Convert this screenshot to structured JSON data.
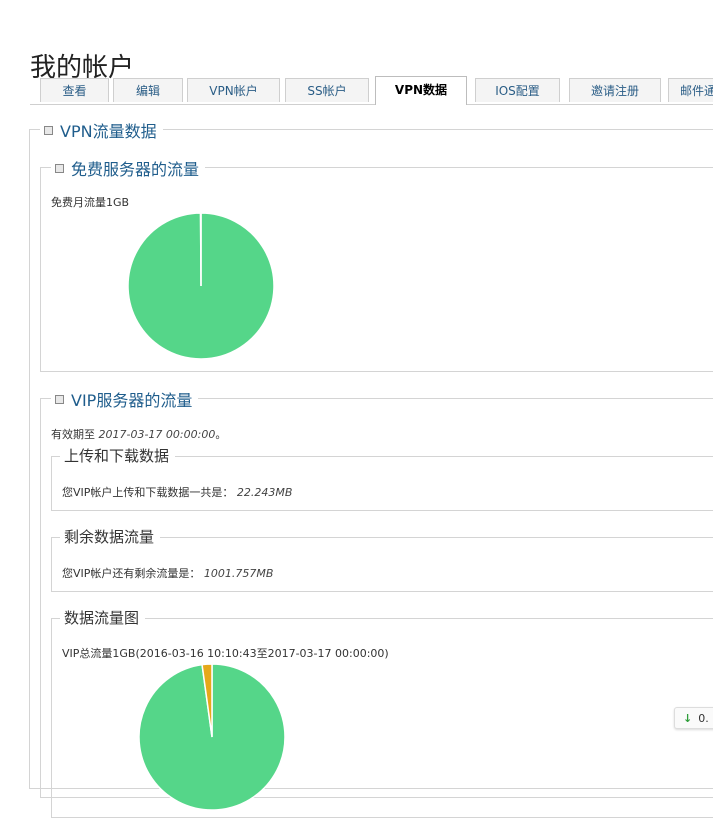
{
  "page": {
    "title": "我的帐户"
  },
  "tabs": [
    {
      "label": "查看"
    },
    {
      "label": "编辑"
    },
    {
      "label": "VPN帐户"
    },
    {
      "label": "SS帐户"
    },
    {
      "label": "VPN数据"
    },
    {
      "label": "IOS配置"
    },
    {
      "label": "邀请注册"
    },
    {
      "label": "邮件通"
    }
  ],
  "active_tab": "VPN数据",
  "vpn_section": {
    "legend": "VPN流量数据",
    "free": {
      "legend": "免费服务器的流量",
      "label": "免费月流量1GB",
      "chart_data": {
        "type": "pie",
        "values": [
          99.9,
          0.1
        ],
        "colors": [
          "#55d689",
          "#ffffff"
        ]
      }
    },
    "vip": {
      "legend": "VIP服务器的流量",
      "expiry_prefix": "有效期至",
      "expiry_value": "2017-03-17 00:00:00",
      "expiry_suffix": "。",
      "updown": {
        "legend": "上传和下载数据",
        "prefix": "您VIP帐户上传和下载数据一共是：",
        "value": "22.243MB"
      },
      "remaining": {
        "legend": "剩余数据流量",
        "prefix": "您VIP帐户还有剩余流量是：",
        "value": "1001.757MB"
      },
      "chart": {
        "legend": "数据流量图",
        "label": "VIP总流量1GB(2016-03-16 10:10:43至2017-03-17 00:00:00)",
        "chart_data": {
          "type": "pie",
          "values": [
            1001.757,
            22.243
          ],
          "colors": [
            "#55d689",
            "#e5a81a"
          ]
        }
      }
    }
  },
  "widget": {
    "arrow": "↓",
    "value": "0."
  }
}
